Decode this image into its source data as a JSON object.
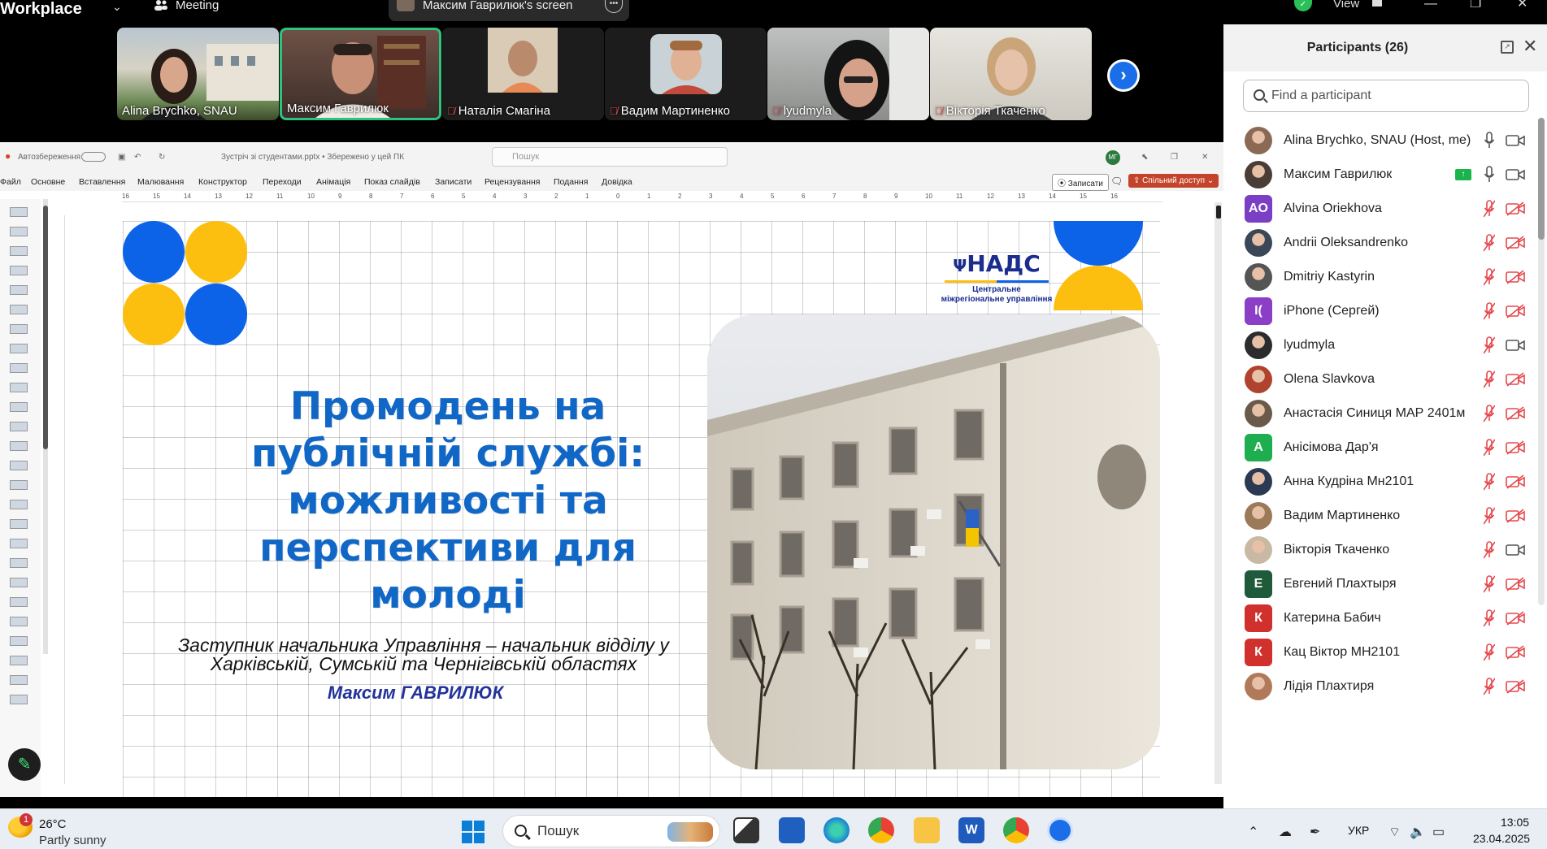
{
  "topbar": {
    "brand": "Workplace",
    "meeting_label": "Meeting",
    "share_label": "Максим Гаврилюк's screen",
    "view_label": "View"
  },
  "videos": [
    {
      "name": "Alina Brychko, SNAU",
      "muted": false,
      "active": false
    },
    {
      "name": "Максим Гаврилюк",
      "muted": false,
      "active": true
    },
    {
      "name": "Наталія Смагіна",
      "muted": true,
      "active": false
    },
    {
      "name": "Вадим Мартиненко",
      "muted": true,
      "active": false
    },
    {
      "name": "lyudmyla",
      "muted": true,
      "active": false
    },
    {
      "name": "Вікторія Ткаченко",
      "muted": true,
      "active": false
    }
  ],
  "ppt": {
    "autosave": "Автозбереження",
    "filename": "Зустріч зі студентами.pptx • Збережено у цей ПК",
    "search": "Пошук",
    "avatar": "МГ",
    "menu": [
      "Файл",
      "Основне",
      "Вставлення",
      "Малювання",
      "Конструктор",
      "Переходи",
      "Анімація",
      "Показ слайдів",
      "Записати",
      "Рецензування",
      "Подання",
      "Довідка"
    ],
    "record_btn": "Записати",
    "share_btn": "Спільний доступ",
    "ruler": [
      "16",
      "15",
      "14",
      "13",
      "12",
      "11",
      "10",
      "9",
      "8",
      "7",
      "6",
      "5",
      "4",
      "3",
      "2",
      "1",
      "0",
      "1",
      "2",
      "3",
      "4",
      "5",
      "6",
      "7",
      "8",
      "9",
      "10",
      "11",
      "12",
      "13",
      "14",
      "15",
      "16"
    ]
  },
  "slide": {
    "title": "Промодень на публічній службі: можливості та перспективи для молоді",
    "subtitle_line1": "Заступник начальника Управління – начальник відділу у",
    "subtitle_line2": "Харківській, Сумській та Чернігівській областях",
    "presenter": "Максим ГАВРИЛЮК",
    "logo_main": "НАДС",
    "logo_sub": "Центральне міжрегіональне управління"
  },
  "panel": {
    "title": "Participants (26)",
    "search_placeholder": "Find a participant",
    "participants": [
      {
        "name": "Alina Brychko, SNAU (Host, me)",
        "avatar": "",
        "color": "#8a6a55",
        "mic": "on",
        "cam": "on",
        "sharing": false
      },
      {
        "name": "Максим Гаврилюк",
        "avatar": "",
        "color": "#4a3d36",
        "mic": "on",
        "cam": "on",
        "sharing": true
      },
      {
        "name": "Alvina Oriekhova",
        "avatar": "AO",
        "color": "#7b3fc6",
        "mic": "off",
        "cam": "off",
        "sharing": false
      },
      {
        "name": "Andrii Oleksandrenko",
        "avatar": "",
        "color": "#3a4757",
        "mic": "off",
        "cam": "off",
        "sharing": false
      },
      {
        "name": "Dmitriy Kastyrin",
        "avatar": "",
        "color": "#555555",
        "mic": "off",
        "cam": "off",
        "sharing": false
      },
      {
        "name": "iPhone (Сергей)",
        "avatar": "I(",
        "color": "#8a3fc6",
        "mic": "off",
        "cam": "off",
        "sharing": false
      },
      {
        "name": "lyudmyla",
        "avatar": "",
        "color": "#2c2c2c",
        "mic": "off",
        "cam": "on",
        "sharing": false
      },
      {
        "name": "Olena Slavkova",
        "avatar": "",
        "color": "#b0432e",
        "mic": "off",
        "cam": "off",
        "sharing": false
      },
      {
        "name": "Анастасія Синиця МАР 2401м",
        "avatar": "",
        "color": "#6a5a4a",
        "mic": "off",
        "cam": "off",
        "sharing": false
      },
      {
        "name": "Анісімова Дар'я",
        "avatar": "А",
        "color": "#1fae4f",
        "mic": "off",
        "cam": "off",
        "sharing": false
      },
      {
        "name": "Анна Кудріна Мн2101",
        "avatar": "",
        "color": "#2b3a52",
        "mic": "off",
        "cam": "off",
        "sharing": false
      },
      {
        "name": "Вадим Мартиненко",
        "avatar": "",
        "color": "#9b7a5a",
        "mic": "off",
        "cam": "off",
        "sharing": false
      },
      {
        "name": "Вікторія Ткаченко",
        "avatar": "",
        "color": "#c9b8a3",
        "mic": "off",
        "cam": "on",
        "sharing": false
      },
      {
        "name": "Евгений Плахтыря",
        "avatar": "Е",
        "color": "#1f5a3a",
        "mic": "off",
        "cam": "off",
        "sharing": false
      },
      {
        "name": "Катерина Бабич",
        "avatar": "К",
        "color": "#d0312d",
        "mic": "off",
        "cam": "off",
        "sharing": false
      },
      {
        "name": "Кац Віктор МН2101",
        "avatar": "К",
        "color": "#d0312d",
        "mic": "off",
        "cam": "off",
        "sharing": false
      },
      {
        "name": "Лідія Плахтиря",
        "avatar": "",
        "color": "#b07a5a",
        "mic": "off",
        "cam": "off",
        "sharing": false
      }
    ]
  },
  "taskbar": {
    "weather_badge": "1",
    "temp": "26°C",
    "weather": "Partly sunny",
    "search": "Пошук",
    "lang": "УКР",
    "time": "13:05",
    "date": "23.04.2025"
  },
  "colors": {
    "slide_blue": "#0c63e7",
    "slide_yellow": "#fdbf0f",
    "title_blue": "#1167c6",
    "muted_red": "#e5484d",
    "active_green": "#2ec27e",
    "zoom_blue": "#1a6fe8"
  }
}
